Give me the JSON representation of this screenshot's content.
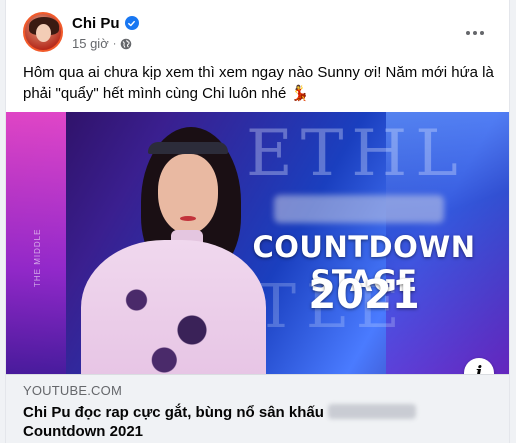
{
  "post": {
    "author": "Chi Pu",
    "verified": true,
    "time": "15 giờ",
    "separator": "·",
    "privacy_icon": "globe-icon",
    "text": "Hôm qua ai chưa kịp xem thì xem ngay nào Sunny ơi! Năm mới hứa là phải \"quẩy\" hết mình cùng Chi luôn nhé 💃"
  },
  "media": {
    "stage_title": "COUNTDOWN STAGE",
    "stage_year": "2021",
    "info_icon": "i"
  },
  "link_preview": {
    "domain": "YOUTUBE.COM",
    "title_line1": "Chi Pu đọc rap cực gắt, bùng nổ sân khấu",
    "title_line2": "Countdown 2021"
  },
  "colors": {
    "verified": "#1877f2",
    "secondary_text": "#65676b",
    "link_bg": "#f0f2f5"
  }
}
